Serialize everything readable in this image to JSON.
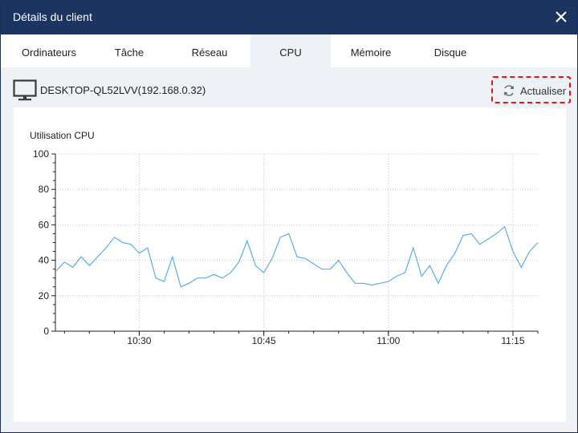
{
  "window": {
    "title": "Détails du client"
  },
  "tabs": [
    {
      "label": "Ordinateurs",
      "active": false
    },
    {
      "label": "Tâche",
      "active": false
    },
    {
      "label": "Réseau",
      "active": false
    },
    {
      "label": "CPU",
      "active": true
    },
    {
      "label": "Mémoire",
      "active": false
    },
    {
      "label": "Disque",
      "active": false
    }
  ],
  "device": {
    "name": "DESKTOP-QL52LVV(192.168.0.32)",
    "icon": "monitor-icon"
  },
  "refresh": {
    "label": "Actualiser",
    "icon": "refresh-icon",
    "highlight_color": "#e8141b"
  },
  "colors": {
    "titlebar": "#1b3460",
    "line": "#5aaee6",
    "background": "#eef1f6"
  },
  "chart_data": {
    "type": "line",
    "title": "Utilisation CPU",
    "xlabel": "",
    "ylabel": "",
    "ylim": [
      0,
      100
    ],
    "yticks": [
      0,
      20,
      40,
      60,
      80,
      100
    ],
    "xticks": [
      "10:30",
      "10:45",
      "11:00",
      "11:15"
    ],
    "x_range": [
      "10:20",
      "11:18"
    ],
    "grid": true,
    "series": [
      {
        "values": [
          {
            "x": "10:20",
            "y": 34
          },
          {
            "x": "10:21",
            "y": 39
          },
          {
            "x": "10:22",
            "y": 36
          },
          {
            "x": "10:23",
            "y": 42
          },
          {
            "x": "10:24",
            "y": 37
          },
          {
            "x": "10:25",
            "y": 42
          },
          {
            "x": "10:26",
            "y": 47
          },
          {
            "x": "10:27",
            "y": 53
          },
          {
            "x": "10:28",
            "y": 50
          },
          {
            "x": "10:29",
            "y": 49
          },
          {
            "x": "10:30",
            "y": 44
          },
          {
            "x": "10:31",
            "y": 47
          },
          {
            "x": "10:32",
            "y": 30
          },
          {
            "x": "10:33",
            "y": 28
          },
          {
            "x": "10:34",
            "y": 42
          },
          {
            "x": "10:35",
            "y": 25
          },
          {
            "x": "10:36",
            "y": 27
          },
          {
            "x": "10:37",
            "y": 30
          },
          {
            "x": "10:38",
            "y": 30
          },
          {
            "x": "10:39",
            "y": 32
          },
          {
            "x": "10:40",
            "y": 30
          },
          {
            "x": "10:41",
            "y": 33
          },
          {
            "x": "10:42",
            "y": 39
          },
          {
            "x": "10:43",
            "y": 51
          },
          {
            "x": "10:44",
            "y": 37
          },
          {
            "x": "10:45",
            "y": 33
          },
          {
            "x": "10:46",
            "y": 41
          },
          {
            "x": "10:47",
            "y": 53
          },
          {
            "x": "10:48",
            "y": 55
          },
          {
            "x": "10:49",
            "y": 42
          },
          {
            "x": "10:50",
            "y": 41
          },
          {
            "x": "10:51",
            "y": 38
          },
          {
            "x": "10:52",
            "y": 35
          },
          {
            "x": "10:53",
            "y": 35
          },
          {
            "x": "10:54",
            "y": 40
          },
          {
            "x": "10:55",
            "y": 33
          },
          {
            "x": "10:56",
            "y": 27
          },
          {
            "x": "10:57",
            "y": 27
          },
          {
            "x": "10:58",
            "y": 26
          },
          {
            "x": "10:59",
            "y": 27
          },
          {
            "x": "11:00",
            "y": 28
          },
          {
            "x": "11:01",
            "y": 31
          },
          {
            "x": "11:02",
            "y": 33
          },
          {
            "x": "11:03",
            "y": 47
          },
          {
            "x": "11:04",
            "y": 31
          },
          {
            "x": "11:05",
            "y": 37
          },
          {
            "x": "11:06",
            "y": 27
          },
          {
            "x": "11:07",
            "y": 37
          },
          {
            "x": "11:08",
            "y": 44
          },
          {
            "x": "11:09",
            "y": 54
          },
          {
            "x": "11:10",
            "y": 55
          },
          {
            "x": "11:11",
            "y": 49
          },
          {
            "x": "11:12",
            "y": 52
          },
          {
            "x": "11:13",
            "y": 55
          },
          {
            "x": "11:14",
            "y": 59
          },
          {
            "x": "11:15",
            "y": 45
          },
          {
            "x": "11:16",
            "y": 36
          },
          {
            "x": "11:17",
            "y": 45
          },
          {
            "x": "11:18",
            "y": 50
          }
        ]
      }
    ]
  }
}
